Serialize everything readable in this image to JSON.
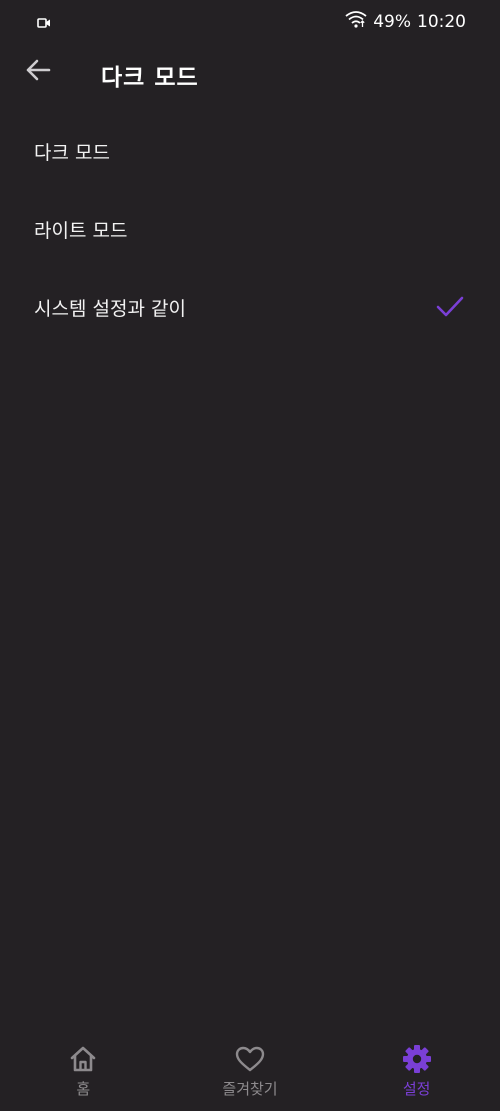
{
  "status_bar": {
    "battery": "49%",
    "time": "10:20"
  },
  "header": {
    "title": "다크 모드"
  },
  "options": [
    {
      "label": "다크 모드",
      "selected": false
    },
    {
      "label": "라이트 모드",
      "selected": false
    },
    {
      "label": "시스템 설정과 같이",
      "selected": true
    }
  ],
  "bottom_nav": {
    "items": [
      {
        "label": "홈",
        "icon": "home-icon",
        "active": false
      },
      {
        "label": "즐겨찾기",
        "icon": "heart-icon",
        "active": false
      },
      {
        "label": "설정",
        "icon": "gear-icon",
        "active": true
      }
    ]
  },
  "colors": {
    "background": "#242124",
    "accent": "#7a3fd6",
    "inactive": "#8d8a8d"
  }
}
